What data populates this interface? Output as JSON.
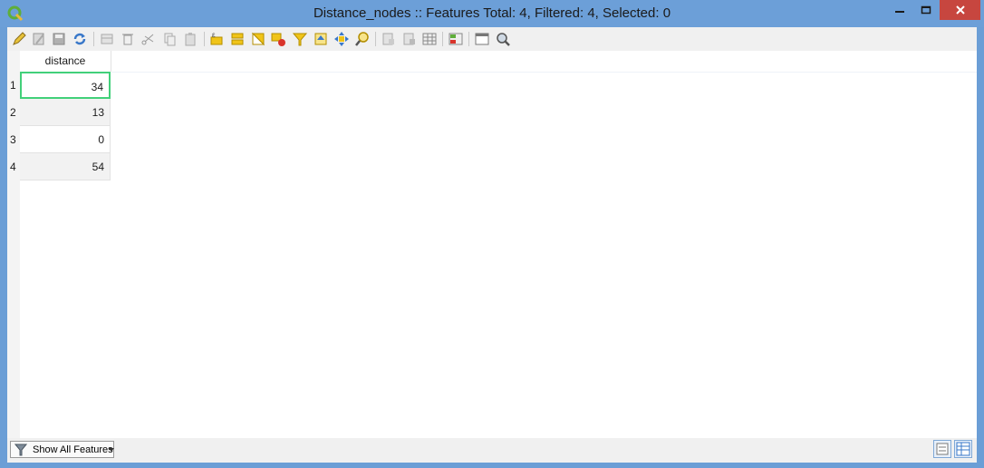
{
  "window": {
    "title": "Distance_nodes :: Features Total: 4, Filtered: 4, Selected: 0",
    "app_icon": "qgis-icon",
    "controls": [
      "minimize-icon",
      "maximize-icon",
      "close-icon"
    ]
  },
  "toolbar": {
    "icons": [
      "toggle-editing-icon",
      "multi-edit-icon",
      "save-edits-icon",
      "reload-icon",
      "add-feature-icon",
      "delete-feature-icon",
      "cut-icon",
      "copy-icon",
      "paste-icon",
      "select-by-expression-icon",
      "select-all-icon",
      "invert-selection-icon",
      "deselect-all-icon",
      "filter-select-icon",
      "move-selection-to-top-icon",
      "pan-to-selected-icon",
      "zoom-to-selected-icon",
      "new-field-icon",
      "delete-field-icon",
      "field-calculator-icon",
      "conditional-formatting-icon",
      "dock-table-icon",
      "actions-icon"
    ]
  },
  "table": {
    "columns": [
      "distance"
    ],
    "rows": [
      {
        "num": "1",
        "distance": "34"
      },
      {
        "num": "2",
        "distance": "13"
      },
      {
        "num": "3",
        "distance": "0"
      },
      {
        "num": "4",
        "distance": "54"
      }
    ],
    "selected_row": 0
  },
  "statusbar": {
    "filter_label": "Show All Features",
    "filter_icon": "filter-icon",
    "view_icons": [
      "form-view-icon",
      "table-view-icon"
    ]
  }
}
